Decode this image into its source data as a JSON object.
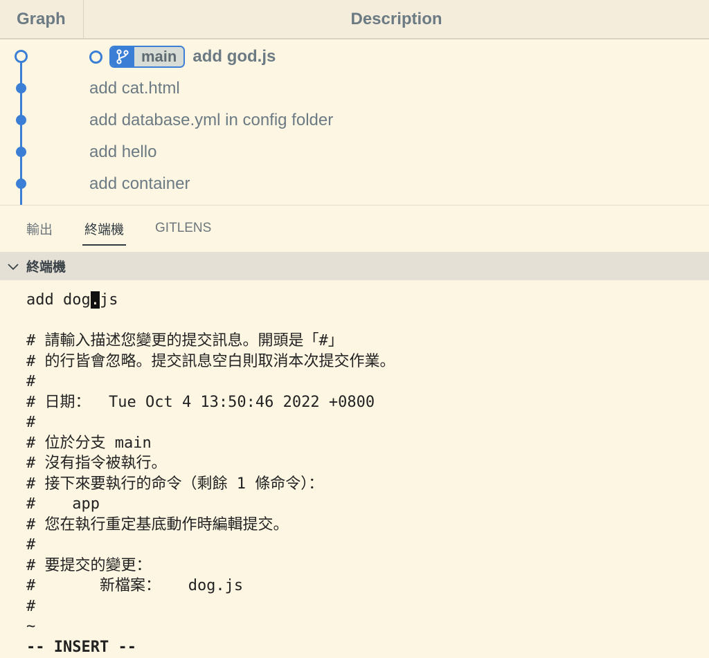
{
  "graph_header": {
    "graph_label": "Graph",
    "description_label": "Description"
  },
  "commits": [
    {
      "message": "add god.js",
      "branch": "main",
      "is_head": true
    },
    {
      "message": "add cat.html"
    },
    {
      "message": "add database.yml in config folder"
    },
    {
      "message": "add hello"
    },
    {
      "message": "add container"
    }
  ],
  "tabs": [
    {
      "label": "輸出"
    },
    {
      "label": "終端機",
      "active": true
    },
    {
      "label": "GITLENS"
    }
  ],
  "terminal_section": {
    "title": "終端機"
  },
  "terminal": {
    "line1_before": "add dog",
    "line1_cursor": ".",
    "line1_after": "js",
    "lines": [
      "",
      "# 請輸入描述您變更的提交訊息。開頭是「#」",
      "# 的行皆會忽略。提交訊息空白則取消本次提交作業。",
      "#",
      "# 日期：  Tue Oct 4 13:50:46 2022 +0800",
      "#",
      "# 位於分支 main",
      "# 沒有指令被執行。",
      "# 接下來要執行的命令（剩餘 1 條命令）：",
      "#    app",
      "# 您在執行重定基底動作時編輯提交。",
      "#",
      "# 要提交的變更：",
      "#       新檔案：   dog.js",
      "#",
      "~"
    ],
    "status": "-- INSERT --"
  },
  "colors": {
    "background": "#fdf6e3",
    "graph_accent": "#3a7fd5",
    "header_bg": "#f4eddb",
    "section_header_bg": "#e4e0d6"
  }
}
